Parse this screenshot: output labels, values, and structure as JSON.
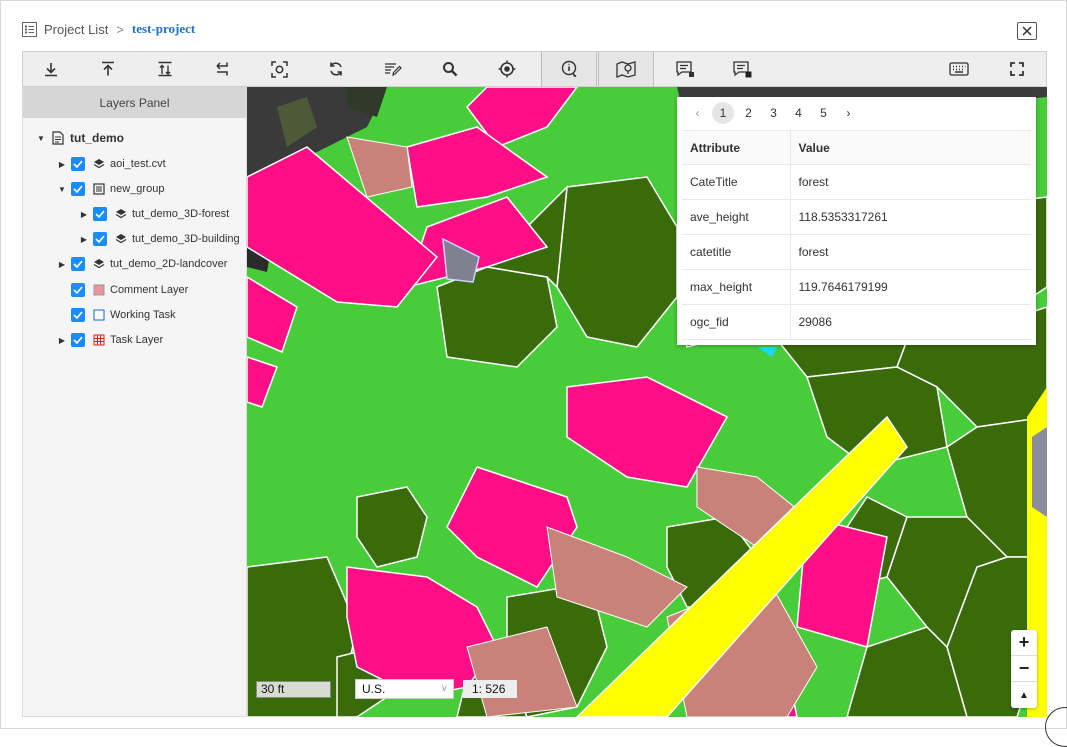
{
  "breadcrumb": {
    "project_list": "Project List",
    "separator": ">",
    "current": "test-project"
  },
  "toolbar": {
    "icons": [
      "download-icon",
      "upload-icon",
      "upload-download-icon",
      "import-icon",
      "screenshot-icon",
      "refresh-icon",
      "edit-icon",
      "search-icon",
      "locate-icon",
      "info-icon",
      "map-marker-icon",
      "comment-icon",
      "task-icon",
      "keyboard-icon",
      "fullscreen-icon"
    ],
    "active": [
      "info-icon",
      "map-marker-icon"
    ]
  },
  "layers_panel": {
    "title": "Layers Panel",
    "root": "tut_demo",
    "items": [
      {
        "label": "aoi_test.cvt",
        "icon": "layers-icon"
      },
      {
        "label": "new_group",
        "icon": "group-icon"
      },
      {
        "label": "tut_demo_3D-forest",
        "icon": "layers-icon"
      },
      {
        "label": "tut_demo_3D-building",
        "icon": "layers-icon"
      },
      {
        "label": "tut_demo_2D-landcover",
        "icon": "layers-icon"
      },
      {
        "label": "Comment Layer",
        "icon": "comment-swatch-icon"
      },
      {
        "label": "Working Task",
        "icon": "working-swatch-icon"
      },
      {
        "label": "Task Layer",
        "icon": "task-grid-icon"
      }
    ]
  },
  "popup": {
    "pages": [
      "1",
      "2",
      "3",
      "4",
      "5"
    ],
    "current_page": "1",
    "prev": "‹",
    "next": "›",
    "columns": [
      "Attribute",
      "Value"
    ],
    "rows": [
      [
        "CateTitle",
        "forest"
      ],
      [
        "ave_height",
        "118.5353317261"
      ],
      [
        "catetitle",
        "forest"
      ],
      [
        "max_height",
        "119.7646179199"
      ],
      [
        "ogc_fid",
        "29086"
      ]
    ]
  },
  "map_controls": {
    "scale_text": "30 ft",
    "units": "U.S.",
    "ratio": "1: 526",
    "zoom_in": "+",
    "zoom_out": "−",
    "north": "▲"
  },
  "colors": {
    "forest": "#3a6b0a",
    "grass": "#48cc3a",
    "building": "#ff0f85",
    "road": "#ffff00",
    "pavement": "#c9827a",
    "selected": "#1a8cff"
  }
}
